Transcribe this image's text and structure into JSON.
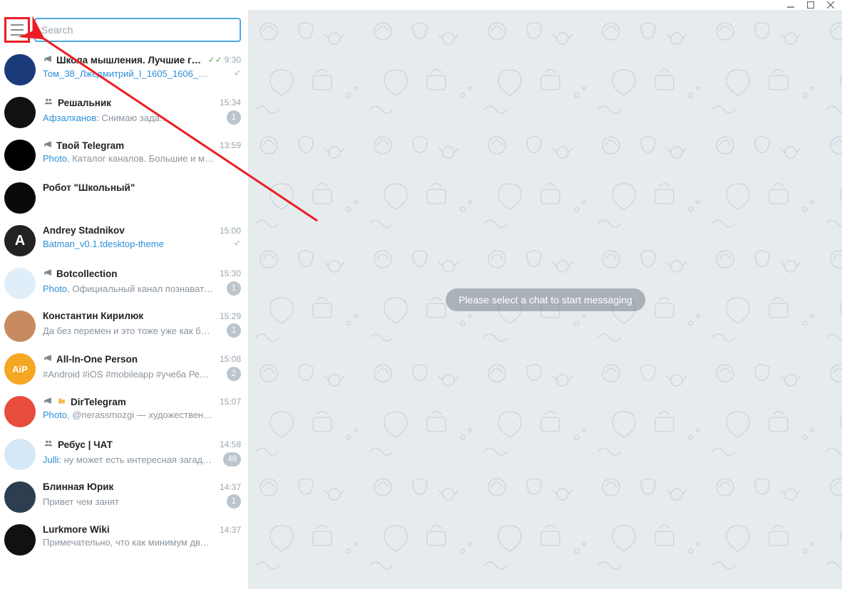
{
  "search": {
    "placeholder": "Search"
  },
  "content": {
    "placeholder": "Please select a chat to start messaging"
  },
  "chats": [
    {
      "type": "channel",
      "title": "Школа мышления. Лучшие го…",
      "checks": true,
      "time": "9:30",
      "msg_link": "Том_38_Лжедмитрий_I_1605_1606_Мос…",
      "msg_sender": "",
      "msg_text": "",
      "pinned": true,
      "badge": "",
      "avatar_bg": "#1a3a7a"
    },
    {
      "type": "group",
      "title": "Решальник",
      "checks": false,
      "time": "15:34",
      "msg_link": "",
      "msg_sender": "Афзалханов:",
      "msg_text": " Снимаю зада…",
      "pinned": false,
      "badge": "1",
      "avatar_bg": "#111"
    },
    {
      "type": "channel",
      "title": "Твой Telegram",
      "checks": false,
      "time": "13:59",
      "msg_link": "Photo",
      "msg_sender": "",
      "msg_text": ", Каталог каналов. Большие и ма…",
      "pinned": false,
      "badge": "",
      "avatar_bg": "#000"
    },
    {
      "type": "",
      "title": "Робот \"Школьный\"",
      "checks": false,
      "time": "",
      "msg_link": "",
      "msg_sender": "",
      "msg_text": "",
      "pinned": false,
      "badge": "",
      "avatar_bg": "#0a0a0a"
    },
    {
      "type": "",
      "title": "Andrey Stadnikov",
      "checks": false,
      "time": "15:00",
      "msg_link": "Batman_v0.1.tdesktop-theme",
      "msg_sender": "",
      "msg_text": "",
      "pinned": true,
      "badge": "",
      "avatar_bg": "#222",
      "avatar_text": "A"
    },
    {
      "type": "channel",
      "title": "Botcollection",
      "checks": false,
      "time": "15:30",
      "msg_link": "Photo",
      "msg_sender": "",
      "msg_text": ", Официальный канал познавател…",
      "pinned": false,
      "badge": "1",
      "avatar_bg": "#e0eef9"
    },
    {
      "type": "",
      "title": "Константин Кирилюк",
      "checks": false,
      "time": "15:29",
      "msg_link": "",
      "msg_sender": "",
      "msg_text": "Да без перемен и это тоже уже как бы …",
      "pinned": false,
      "badge": "1",
      "avatar_bg": "#c78b5f"
    },
    {
      "type": "channel",
      "title": "All-In-One Person",
      "checks": false,
      "time": "15:08",
      "msg_link": "",
      "msg_sender": "",
      "msg_text": "#Android #iOS #mobileapp #учеба  Реш…",
      "pinned": false,
      "badge": "2",
      "avatar_bg": "#f5a623",
      "avatar_text": "AiP"
    },
    {
      "type": "channel",
      "title": "DirTelegram",
      "checks": false,
      "time": "15:07",
      "folder": true,
      "msg_link": "Photo",
      "msg_sender": "",
      "msg_text": ", @nerassmozgi — художественная #л…",
      "pinned": false,
      "badge": "",
      "avatar_bg": "#e74c3c"
    },
    {
      "type": "group",
      "title": "Ребус | ЧАТ",
      "checks": false,
      "time": "14:58",
      "msg_link": "",
      "msg_sender": "Julli:",
      "msg_text": " ну может есть интересная загадка…",
      "pinned": false,
      "badge": "48",
      "avatar_bg": "#d5e8f7"
    },
    {
      "type": "",
      "title": "Блинная Юрик",
      "checks": false,
      "time": "14:37",
      "msg_link": "",
      "msg_sender": "",
      "msg_text": "Привет чем занят",
      "pinned": false,
      "badge": "1",
      "avatar_bg": "#2c3e50"
    },
    {
      "type": "",
      "title": "Lurkmore Wiki",
      "checks": false,
      "time": "14:37",
      "msg_link": "",
      "msg_sender": "",
      "msg_text": "Примечательно, что как минимум двое бу…",
      "pinned": false,
      "badge": "",
      "avatar_bg": "#111"
    }
  ]
}
